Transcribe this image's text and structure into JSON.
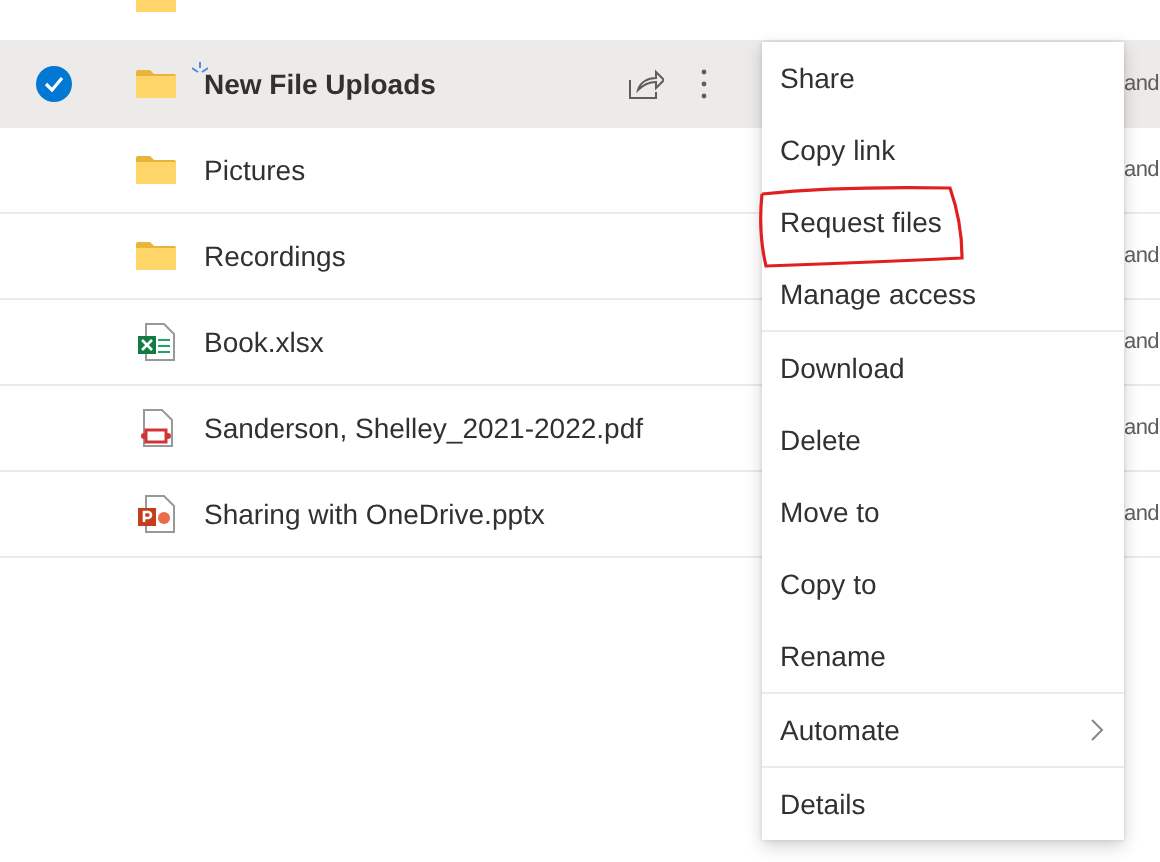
{
  "files": [
    {
      "kind": "folder",
      "selected": false
    },
    {
      "name": "New File Uploads",
      "kind": "folder",
      "selected": true,
      "new": true,
      "modified_by": "and"
    },
    {
      "name": "Pictures",
      "kind": "folder",
      "selected": false,
      "new": false,
      "modified_by": "and"
    },
    {
      "name": "Recordings",
      "kind": "folder",
      "selected": false,
      "new": false,
      "modified_by": "and"
    },
    {
      "name": "Book.xlsx",
      "kind": "xlsx",
      "selected": false,
      "new": false,
      "modified_by": "and"
    },
    {
      "name": "Sanderson, Shelley_2021-2022.pdf",
      "kind": "pdf",
      "selected": false,
      "new": false,
      "modified_by": "and"
    },
    {
      "name": "Sharing with OneDrive.pptx",
      "kind": "pptx",
      "selected": false,
      "new": false,
      "modified_by": "and"
    }
  ],
  "context_menu": [
    [
      {
        "label": "Share",
        "highlighted": false,
        "submenu": false
      },
      {
        "label": "Copy link",
        "highlighted": false,
        "submenu": false
      },
      {
        "label": "Request files",
        "highlighted": true,
        "submenu": false
      },
      {
        "label": "Manage access",
        "highlighted": false,
        "submenu": false
      }
    ],
    [
      {
        "label": "Download",
        "highlighted": false,
        "submenu": false
      },
      {
        "label": "Delete",
        "highlighted": false,
        "submenu": false
      },
      {
        "label": "Move to",
        "highlighted": false,
        "submenu": false
      },
      {
        "label": "Copy to",
        "highlighted": false,
        "submenu": false
      },
      {
        "label": "Rename",
        "highlighted": false,
        "submenu": false
      }
    ],
    [
      {
        "label": "Automate",
        "highlighted": false,
        "submenu": true
      }
    ],
    [
      {
        "label": "Details",
        "highlighted": false,
        "submenu": false
      }
    ]
  ]
}
